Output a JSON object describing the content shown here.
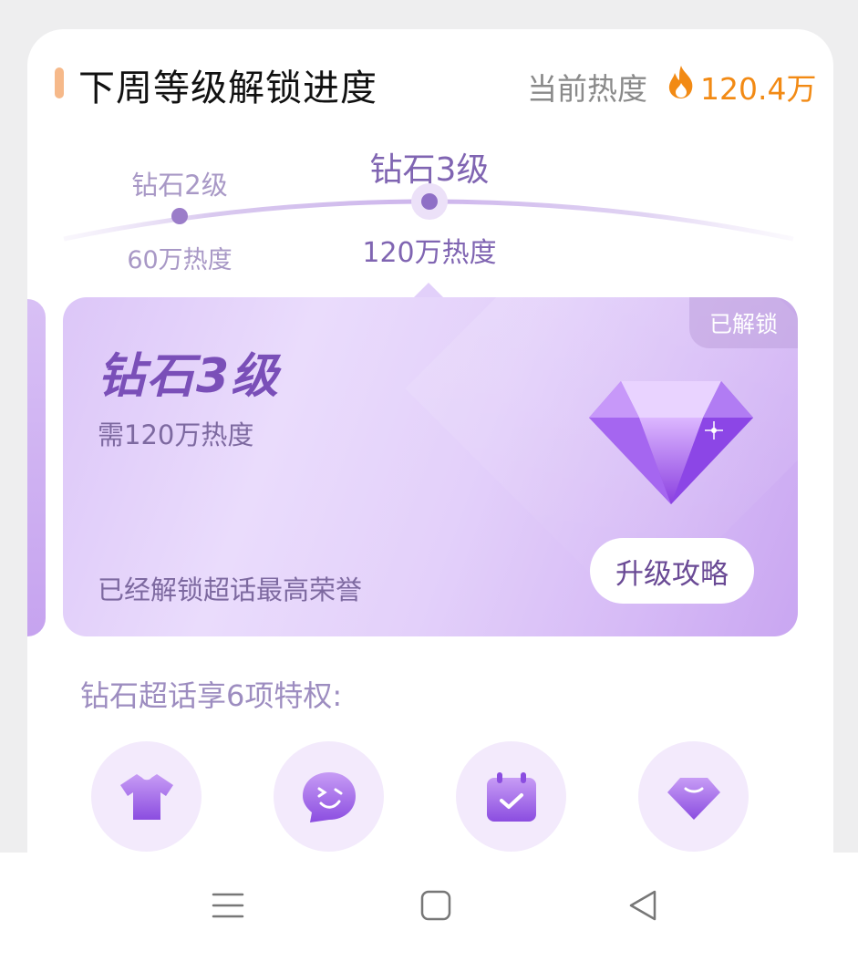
{
  "header": {
    "title": "下周等级解锁进度",
    "heat_label": "当前热度",
    "heat_value": "120.4万",
    "fire_icon": "fire-icon"
  },
  "levels": [
    {
      "name": "钻石2级",
      "heat": "60万热度"
    },
    {
      "name": "钻石3级",
      "heat": "120万热度"
    }
  ],
  "card": {
    "badge": "已解锁",
    "level": "钻石3级",
    "requirement": "需120万热度",
    "status": "已经解锁超话最高荣誉",
    "button": "升级攻略",
    "gem_icon": "diamond-gem-icon"
  },
  "privileges": {
    "title": "钻石超话享6项特权:",
    "icons": [
      "tshirt-icon",
      "chat-smile-icon",
      "calendar-check-icon",
      "diamond-icon"
    ]
  },
  "navbar": {
    "icons": [
      "menu-icon",
      "home-icon",
      "back-icon"
    ]
  },
  "colors": {
    "accent": "#f28a14",
    "purple": "#8065b2",
    "card_gradient_start": "#dcc6f8",
    "card_gradient_end": "#c9a6f1"
  }
}
